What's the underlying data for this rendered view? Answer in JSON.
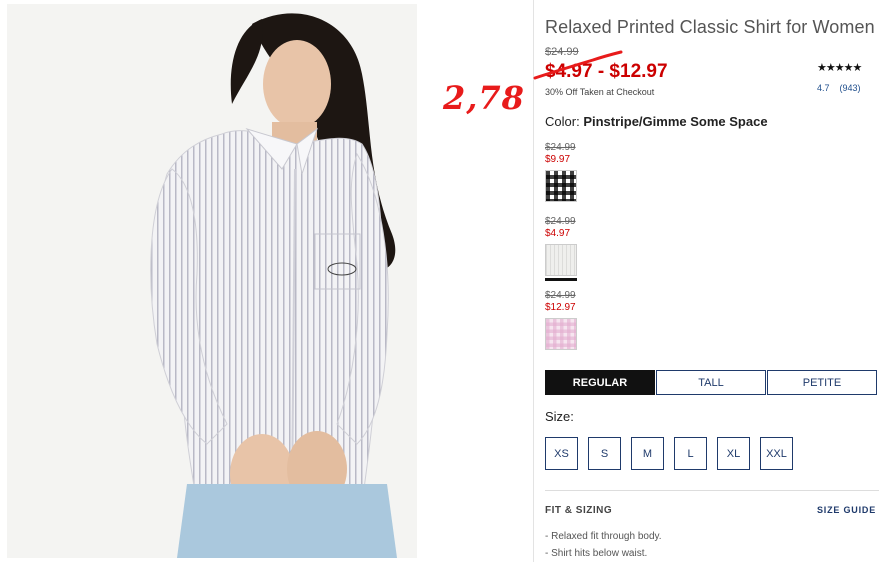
{
  "product": {
    "title": "Relaxed Printed Classic Shirt for Women",
    "original_price": "$24.99",
    "price_range": "$4.97 - $12.97",
    "discount_note": "30% Off Taken at Checkout",
    "stars": "★★★★★",
    "rating": "4.7",
    "review_count": "(943)"
  },
  "annotation": {
    "handwritten_price": "2,78",
    "color": "#e81b1b"
  },
  "color_selector": {
    "label": "Color:",
    "selected_name": "Pinstripe/Gimme Some Space",
    "swatches": [
      {
        "original": "$24.99",
        "sale": "$9.97",
        "pattern": "black-white-gingham"
      },
      {
        "original": "$24.99",
        "sale": "$4.97",
        "pattern": "grey-pinstripe",
        "selected": true
      },
      {
        "original": "$24.99",
        "sale": "$12.97",
        "pattern": "pink-gingham"
      }
    ]
  },
  "fit_tabs": [
    {
      "label": "REGULAR",
      "active": true
    },
    {
      "label": "TALL",
      "active": false
    },
    {
      "label": "PETITE",
      "active": false
    }
  ],
  "size": {
    "label": "Size:",
    "options": [
      "XS",
      "S",
      "M",
      "L",
      "XL",
      "XXL"
    ]
  },
  "fit_sizing": {
    "heading": "FIT & SIZING",
    "guide_link": "SIZE GUIDE",
    "bullets": [
      "- Relaxed fit through body.",
      "- Shirt hits below waist."
    ]
  },
  "colors": {
    "sale_red": "#cc0000",
    "navy": "#1f3a6b",
    "active_tab": "#111111"
  }
}
